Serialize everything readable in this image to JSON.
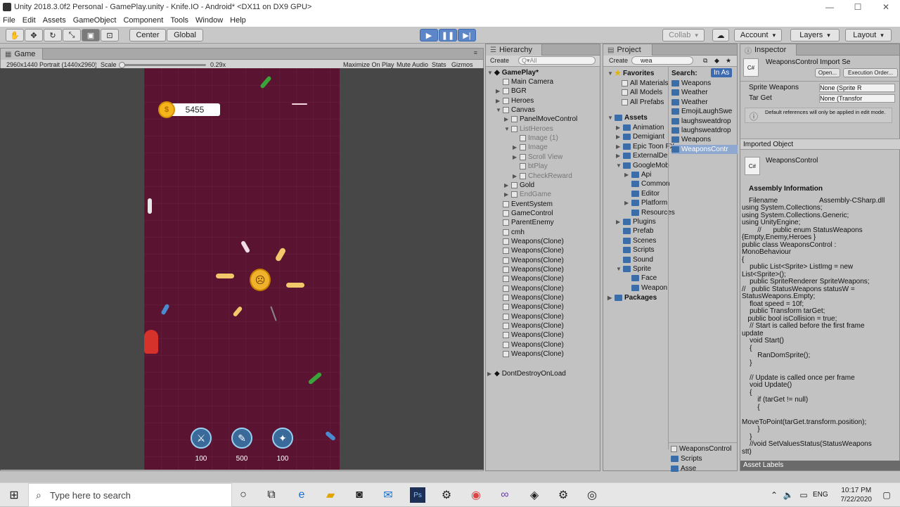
{
  "window": {
    "title": "Unity 2018.3.0f2 Personal - GamePlay.unity - Knife.IO - Android* <DX11 on DX9 GPU>",
    "min": "—",
    "max": "☐",
    "close": "✕"
  },
  "menu": [
    "File",
    "Edit",
    "Assets",
    "GameObject",
    "Component",
    "Tools",
    "Window",
    "Help"
  ],
  "toolbar": {
    "center": "Center",
    "global": "Global",
    "collab": "Collab",
    "account": "Account",
    "layers": "Layers",
    "layout": "Layout"
  },
  "game": {
    "tab": "Game",
    "resolution": "2960x1440 Portrait (1440x2960)",
    "scale_label": "Scale",
    "scale_value": "0.29x",
    "maximize": "Maximize On Play",
    "mute": "Mute Audio",
    "stats": "Stats",
    "gizmos": "Gizmos",
    "coins": "5455",
    "heroes": [
      {
        "price": "100"
      },
      {
        "price": "500"
      },
      {
        "price": "100"
      }
    ]
  },
  "hierarchy": {
    "tab": "Hierarchy",
    "create": "Create",
    "search_placeholder": "Q▾All",
    "scene": "GamePlay*",
    "items": [
      {
        "label": "Main Camera",
        "depth": 1,
        "arrow": "",
        "dim": false
      },
      {
        "label": "BGR",
        "depth": 1,
        "arrow": "▶",
        "dim": false
      },
      {
        "label": "Heroes",
        "depth": 1,
        "arrow": "▶",
        "dim": false
      },
      {
        "label": "Canvas",
        "depth": 1,
        "arrow": "▼",
        "dim": false
      },
      {
        "label": "PanelMoveControl",
        "depth": 2,
        "arrow": "▶",
        "dim": false
      },
      {
        "label": "ListHeroes",
        "depth": 2,
        "arrow": "▼",
        "dim": true
      },
      {
        "label": "Image (1)",
        "depth": 3,
        "arrow": "",
        "dim": true
      },
      {
        "label": "Image",
        "depth": 3,
        "arrow": "▶",
        "dim": true
      },
      {
        "label": "Scroll View",
        "depth": 3,
        "arrow": "▶",
        "dim": true
      },
      {
        "label": "btPlay",
        "depth": 3,
        "arrow": "",
        "dim": true
      },
      {
        "label": "CheckReward",
        "depth": 3,
        "arrow": "▶",
        "dim": true
      },
      {
        "label": "Gold",
        "depth": 2,
        "arrow": "▶",
        "dim": false
      },
      {
        "label": "EndGame",
        "depth": 2,
        "arrow": "▶",
        "dim": true
      },
      {
        "label": "EventSystem",
        "depth": 1,
        "arrow": "",
        "dim": false
      },
      {
        "label": "GameControl",
        "depth": 1,
        "arrow": "",
        "dim": false
      },
      {
        "label": "ParentEnemy",
        "depth": 1,
        "arrow": "",
        "dim": false
      },
      {
        "label": "cmh",
        "depth": 1,
        "arrow": "",
        "dim": false
      },
      {
        "label": "Weapons(Clone)",
        "depth": 1,
        "arrow": "",
        "dim": false
      },
      {
        "label": "Weapons(Clone)",
        "depth": 1,
        "arrow": "",
        "dim": false
      },
      {
        "label": "Weapons(Clone)",
        "depth": 1,
        "arrow": "",
        "dim": false
      },
      {
        "label": "Weapons(Clone)",
        "depth": 1,
        "arrow": "",
        "dim": false
      },
      {
        "label": "Weapons(Clone)",
        "depth": 1,
        "arrow": "",
        "dim": false
      },
      {
        "label": "Weapons(Clone)",
        "depth": 1,
        "arrow": "",
        "dim": false
      },
      {
        "label": "Weapons(Clone)",
        "depth": 1,
        "arrow": "",
        "dim": false
      },
      {
        "label": "Weapons(Clone)",
        "depth": 1,
        "arrow": "",
        "dim": false
      },
      {
        "label": "Weapons(Clone)",
        "depth": 1,
        "arrow": "",
        "dim": false
      },
      {
        "label": "Weapons(Clone)",
        "depth": 1,
        "arrow": "",
        "dim": false
      },
      {
        "label": "Weapons(Clone)",
        "depth": 1,
        "arrow": "",
        "dim": false
      },
      {
        "label": "Weapons(Clone)",
        "depth": 1,
        "arrow": "",
        "dim": false
      },
      {
        "label": "Weapons(Clone)",
        "depth": 1,
        "arrow": "",
        "dim": false
      }
    ],
    "dontdestroy": "DontDestroyOnLoad"
  },
  "project": {
    "tab": "Project",
    "create": "Create",
    "search_value": "wea",
    "search_label": "Search:",
    "in_assets": "In As",
    "favorites": "Favorites",
    "fav_items": [
      "All Materials",
      "All Models",
      "All Prefabs"
    ],
    "assets": "Assets",
    "asset_items": [
      {
        "label": "Animation",
        "depth": 1,
        "arrow": "▶"
      },
      {
        "label": "Demigiant",
        "depth": 1,
        "arrow": "▶"
      },
      {
        "label": "Epic Toon FX",
        "depth": 1,
        "arrow": "▶"
      },
      {
        "label": "ExternalDe",
        "depth": 1,
        "arrow": "▶"
      },
      {
        "label": "GoogleMob",
        "depth": 1,
        "arrow": "▼"
      },
      {
        "label": "Api",
        "depth": 2,
        "arrow": "▶"
      },
      {
        "label": "Common",
        "depth": 2,
        "arrow": ""
      },
      {
        "label": "Editor",
        "depth": 2,
        "arrow": ""
      },
      {
        "label": "Platform",
        "depth": 2,
        "arrow": "▶"
      },
      {
        "label": "Resources",
        "depth": 2,
        "arrow": ""
      },
      {
        "label": "Plugins",
        "depth": 1,
        "arrow": "▶"
      },
      {
        "label": "Prefab",
        "depth": 1,
        "arrow": ""
      },
      {
        "label": "Scenes",
        "depth": 1,
        "arrow": ""
      },
      {
        "label": "Scripts",
        "depth": 1,
        "arrow": ""
      },
      {
        "label": "Sound",
        "depth": 1,
        "arrow": ""
      },
      {
        "label": "Sprite",
        "depth": 1,
        "arrow": "▼"
      },
      {
        "label": "Face",
        "depth": 2,
        "arrow": ""
      },
      {
        "label": "Weapon",
        "depth": 2,
        "arrow": ""
      }
    ],
    "packages": "Packages",
    "results": [
      "Weapons",
      "Weather",
      "Weather",
      "EmojiLaughSwe",
      "laughsweatdrop",
      "laughsweatdrop",
      "Weapons",
      "WeaponsContr"
    ],
    "path": [
      "WeaponsControl",
      "Scripts",
      "Asse"
    ]
  },
  "inspector": {
    "tab": "Inspector",
    "title": "WeaponsControl Import Se",
    "open": "Open...",
    "exec_order": "Execution Order...",
    "fields": [
      {
        "label": "Sprite Weapons",
        "value": "None (Sprite R"
      },
      {
        "label": "Tar Get",
        "value": "None (Transfor"
      }
    ],
    "note": "Default references will only be applied in edit mode.",
    "imported_object": "Imported Object",
    "script_name": "WeaponsControl",
    "assembly_info": "Assembly Information",
    "filename_label": "Filename",
    "filename_value": "Assembly-CSharp.dll",
    "code": "using System.Collections;\nusing System.Collections.Generic;\nusing UnityEngine;\n        //      public enum StatusWeapons\n{Empty,Enemy,Heroes }\npublic class WeaponsControl :\nMonoBehaviour\n{\n    public List<Sprite> ListImg = new\nList<Sprite>();\n    public SpriteRenderer SpriteWeapons;\n//   public StatusWeapons statusW =\nStatusWeapons.Empty;\n    float speed = 10f;\n    public Transform tarGet;\n   public bool isCollision = true;\n    // Start is called before the first frame\nupdate\n    void Start()\n    {\n        RanDomSprite();\n    }\n\n    // Update is called once per frame\n    void Update()\n    {\n        if (tarGet != null)\n        {\n\nMoveToPoint(tarGet.transform.position);\n        }\n    }\n    //void SetValuesStatus(StatusWeapons\nstt)",
    "asset_labels": "Asset Labels"
  },
  "taskbar": {
    "search_placeholder": "Type here to search",
    "lang": "ENG",
    "time": "10:17 PM",
    "date": "7/22/2020"
  },
  "colors": {
    "game_bg": "#5a1432",
    "play_blue": "#5c86c8",
    "coin": "#f3b51b"
  }
}
